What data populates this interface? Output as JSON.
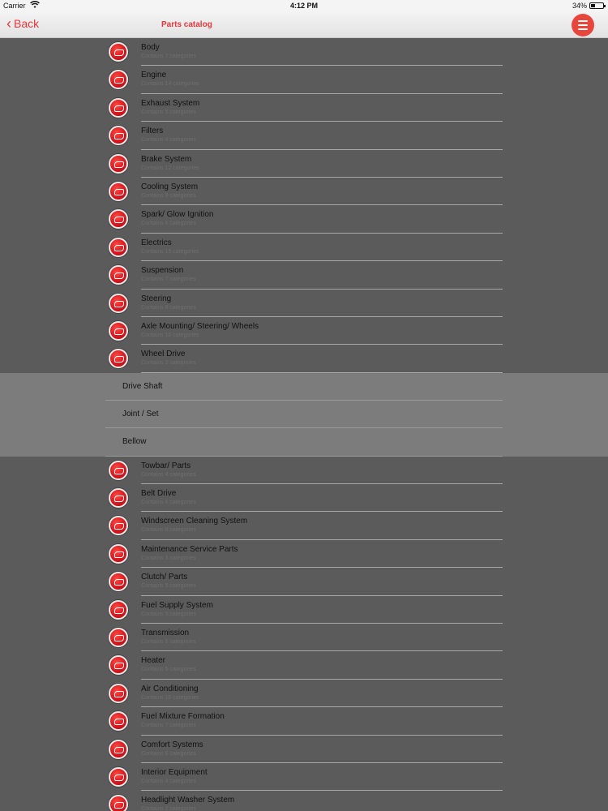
{
  "status": {
    "carrier": "Carrier",
    "time": "4:12 PM",
    "battery": "34%",
    "battery_level": 0.34
  },
  "nav": {
    "back_label": "Back",
    "title": "Parts catalog"
  },
  "categories_before": [
    {
      "title": "Body",
      "subtitle": "Contains 7 categories"
    },
    {
      "title": "Engine",
      "subtitle": "Contains 14 categories"
    },
    {
      "title": "Exhaust System",
      "subtitle": "Contains 5 categories"
    },
    {
      "title": "Filters",
      "subtitle": "Contains 4 categories"
    },
    {
      "title": "Brake System",
      "subtitle": "Contains 12 categories"
    },
    {
      "title": "Cooling System",
      "subtitle": "Contains 9 categories"
    },
    {
      "title": "Spark/ Glow Ignition",
      "subtitle": "Contains 6 categories"
    },
    {
      "title": "Electrics",
      "subtitle": "Contains 15 categories"
    },
    {
      "title": "Suspension",
      "subtitle": "Contains 7 categories"
    },
    {
      "title": "Steering",
      "subtitle": "Contains 8 categories"
    },
    {
      "title": "Axle Mounting/ Steering/ Wheels",
      "subtitle": "Contains 10 categories"
    },
    {
      "title": "Wheel Drive",
      "subtitle": "Contains 3 categories"
    }
  ],
  "expanded_subcategories": [
    "Drive Shaft",
    "Joint / Set",
    "Bellow"
  ],
  "categories_after": [
    {
      "title": "Towbar/ Parts",
      "subtitle": "Contains 4 categories"
    },
    {
      "title": "Belt Drive",
      "subtitle": "Contains 6 categories"
    },
    {
      "title": "Windscreen Cleaning System",
      "subtitle": "Contains 8 categories"
    },
    {
      "title": "Maintenance Service Parts",
      "subtitle": "Contains 3 categories"
    },
    {
      "title": "Clutch/ Parts",
      "subtitle": "Contains 5 categories"
    },
    {
      "title": "Fuel Supply System",
      "subtitle": "Contains 9 categories"
    },
    {
      "title": "Transmission",
      "subtitle": "Contains 6 categories"
    },
    {
      "title": "Heater",
      "subtitle": "Contains 5 categories"
    },
    {
      "title": "Air Conditioning",
      "subtitle": "Contains 10 categories"
    },
    {
      "title": "Fuel Mixture Formation",
      "subtitle": "Contains 7 categories"
    },
    {
      "title": "Comfort Systems",
      "subtitle": "Contains 6 categories"
    },
    {
      "title": "Interior Equipment",
      "subtitle": "Contains 4 categories"
    },
    {
      "title": "Headlight Washer System",
      "subtitle": "Contains 2 categories"
    }
  ]
}
